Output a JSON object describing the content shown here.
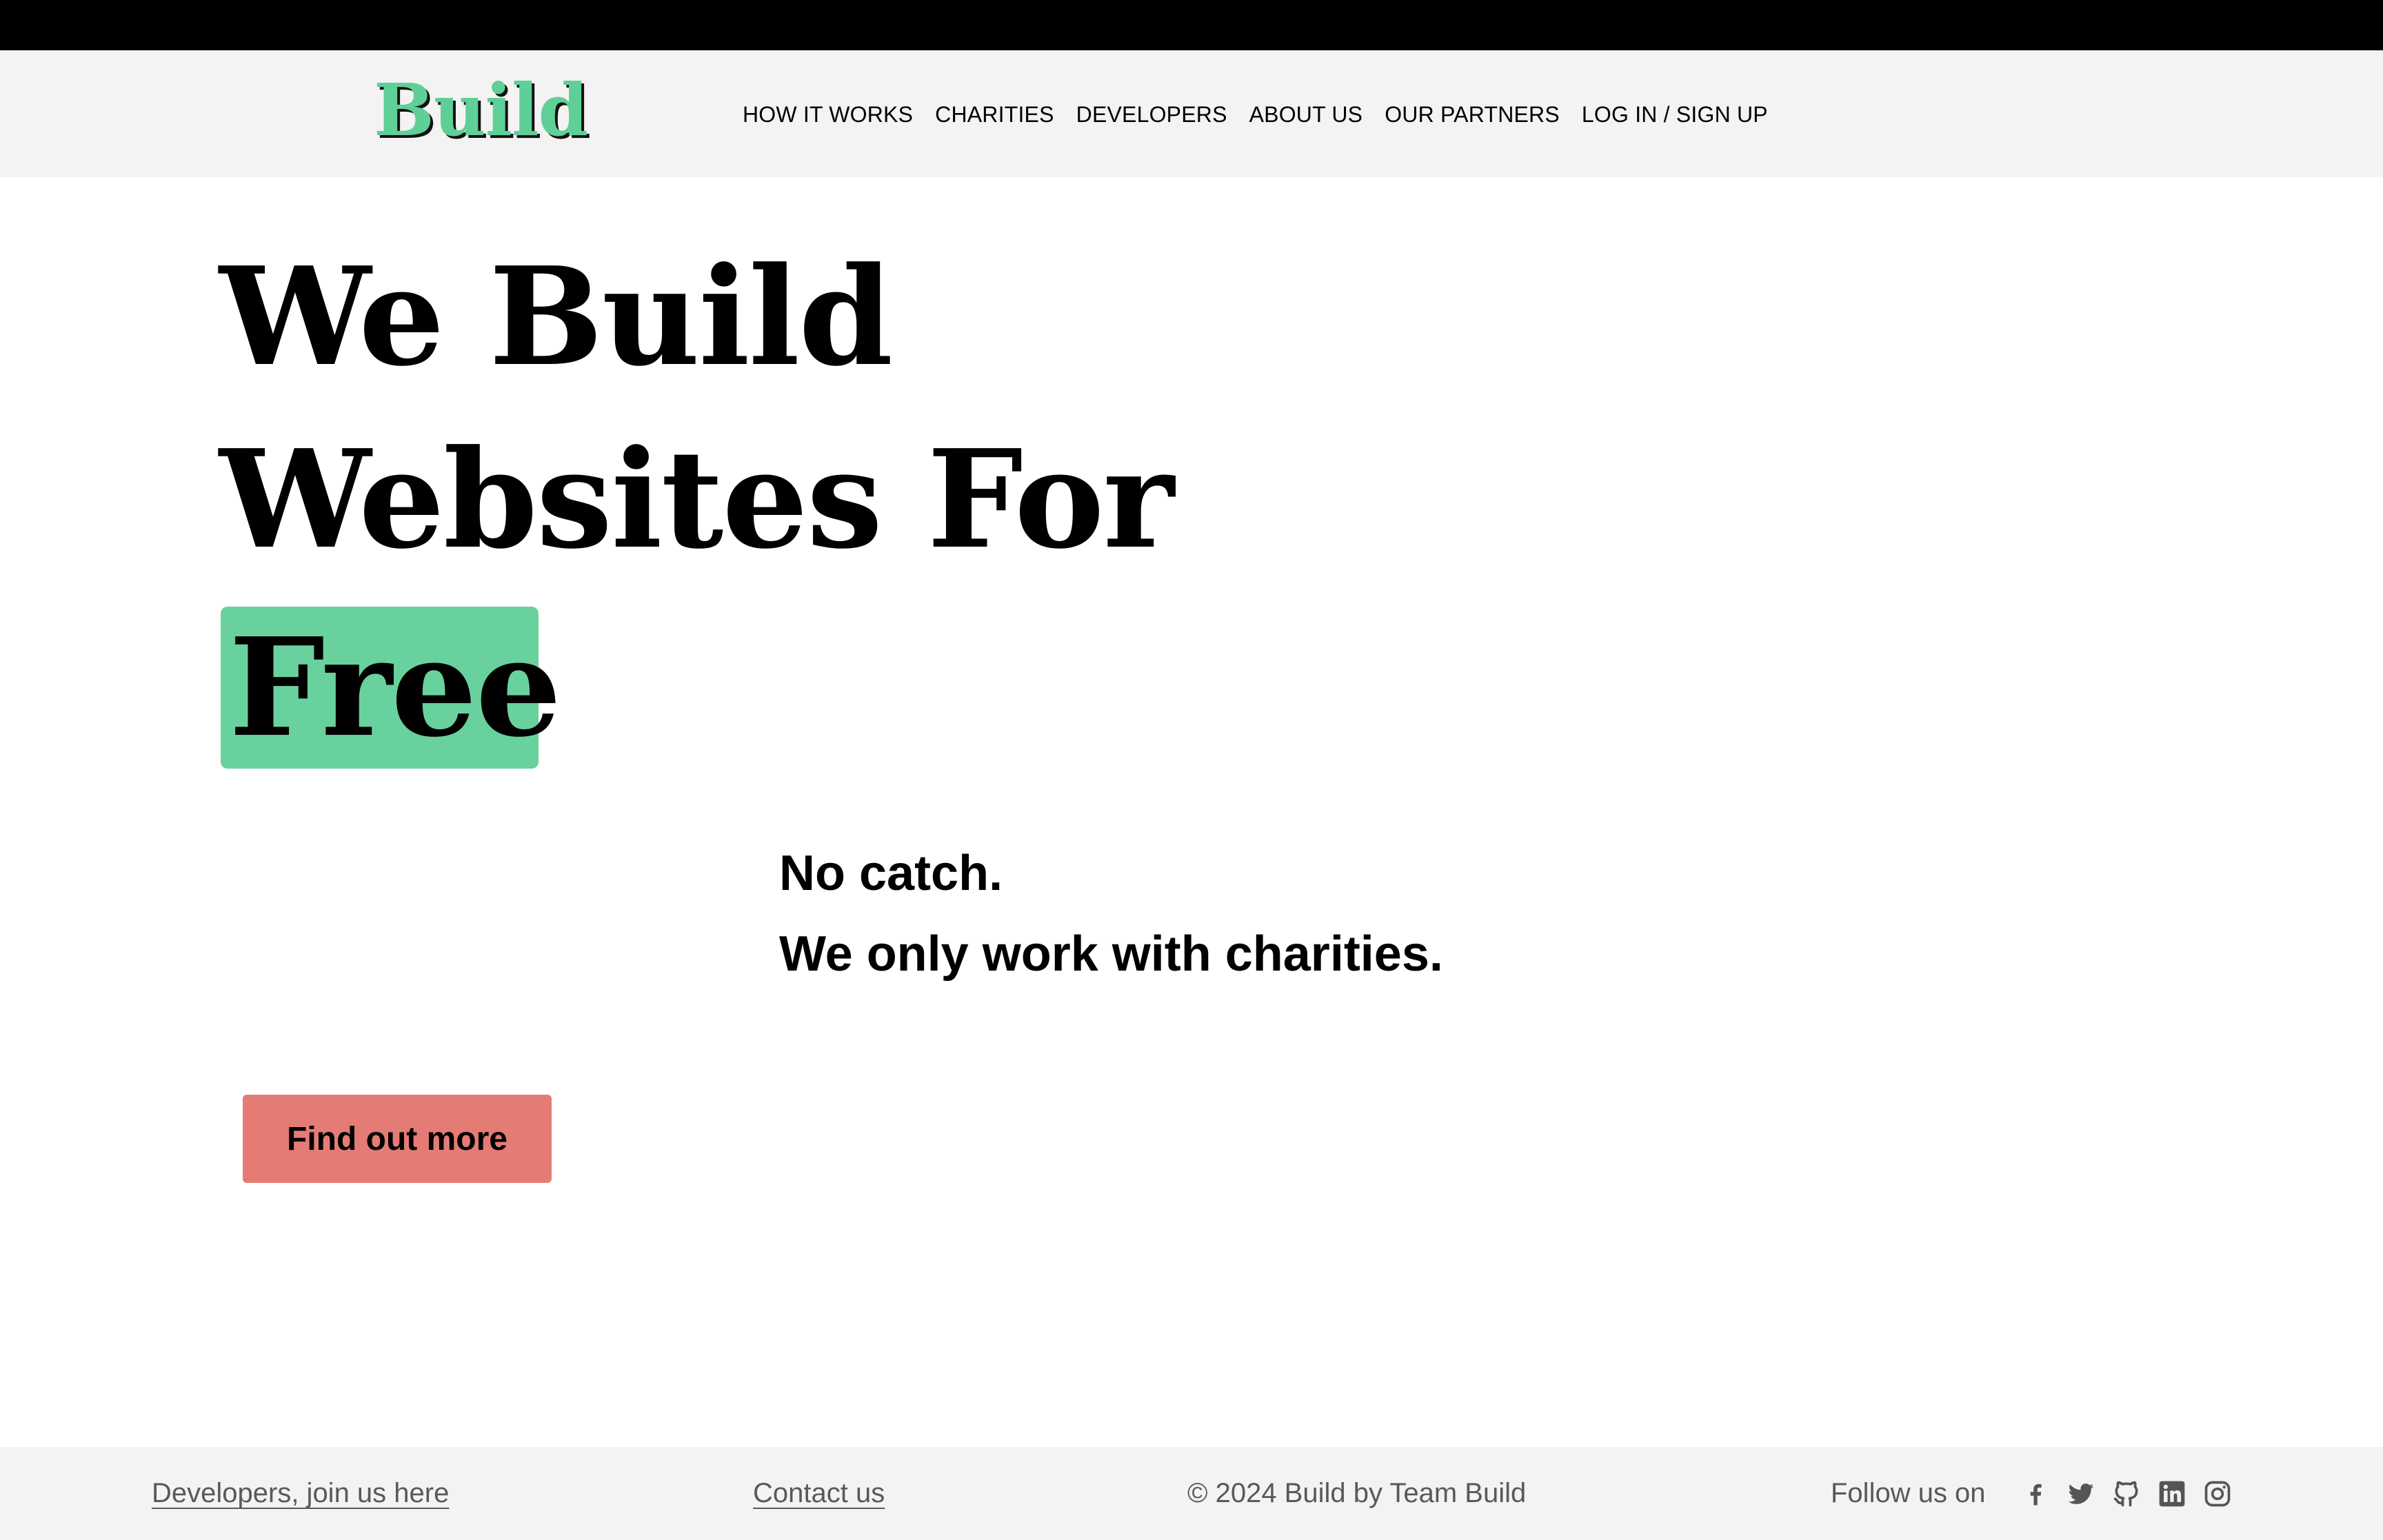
{
  "brand": {
    "logo": "Build",
    "accent_color": "#69d19d",
    "cta_color": "#e57b75"
  },
  "nav": {
    "items": [
      {
        "label": "HOW IT WORKS"
      },
      {
        "label": "CHARITIES"
      },
      {
        "label": "DEVELOPERS"
      },
      {
        "label": "ABOUT US"
      },
      {
        "label": "OUR PARTNERS"
      },
      {
        "label": "LOG IN / SIGN UP"
      }
    ]
  },
  "hero": {
    "line1": "We Build",
    "line2": "Websites For",
    "highlight": "Free",
    "sub1": "No catch.",
    "sub2": "We only work with charities.",
    "cta_label": "Find out more"
  },
  "footer": {
    "developers_link": "Developers, join us here",
    "contact_link": "Contact us",
    "copyright": "© 2024 Build by Team Build",
    "follow_label": "Follow us on",
    "social_icons": [
      "facebook-icon",
      "twitter-icon",
      "github-icon",
      "linkedin-icon",
      "instagram-icon"
    ]
  }
}
